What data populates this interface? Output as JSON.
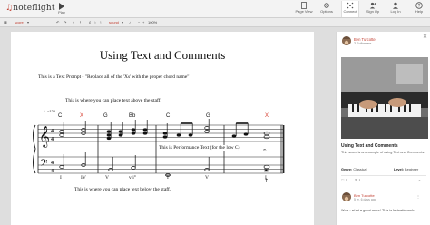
{
  "app": {
    "logo_text": "noteflight"
  },
  "topbar": {
    "play_label": "Play",
    "nav": [
      {
        "label": "Page View",
        "icon": "page-view-icon"
      },
      {
        "label": "Options",
        "icon": "options-icon"
      },
      {
        "label": "Connect",
        "icon": "connect-icon"
      },
      {
        "label": "Sign Up",
        "icon": "sign-up-icon"
      },
      {
        "label": "Log In",
        "icon": "log-in-icon"
      },
      {
        "label": "Help",
        "icon": "help-icon"
      }
    ]
  },
  "toolbar": {
    "score_label": "score",
    "sound_label": "sound",
    "zoom_label": "100%"
  },
  "score": {
    "title": "Using Text and Comments",
    "text_prompt": "This is a Text Prompt - \"Replace all of the 'Xs' with the proper chord name\"",
    "text_above": "This is where you can place text above the staff.",
    "performance_text": "This is Performance Text (for the low C)",
    "text_below": "This is where you can place text below the staff.",
    "tempo": "♩=120",
    "chords": [
      "C",
      "X",
      "G",
      "Bb",
      "C",
      "G",
      "X"
    ],
    "roman_numerals": [
      "I",
      "IV",
      "V",
      "vii°",
      "I",
      "V",
      "I"
    ]
  },
  "panel": {
    "user_name": "Ben Turcotte",
    "followers": "2 Followers",
    "score_title": "Using Text and Comments",
    "description": "This score is an example of using Text and Comments.",
    "genre_label": "Genre:",
    "genre_value": "Classical",
    "level_label": "Level:",
    "level_value": "Beginner",
    "likes": "1",
    "comments_count": "1",
    "comment_user": "Ben Turcotte",
    "comment_time": "5 yr, 6 days ago",
    "comment_text": "Wow - what a great score! This is fantastic work."
  },
  "colors": {
    "accent": "#c0392b",
    "x_marker": "#d63a2c"
  }
}
